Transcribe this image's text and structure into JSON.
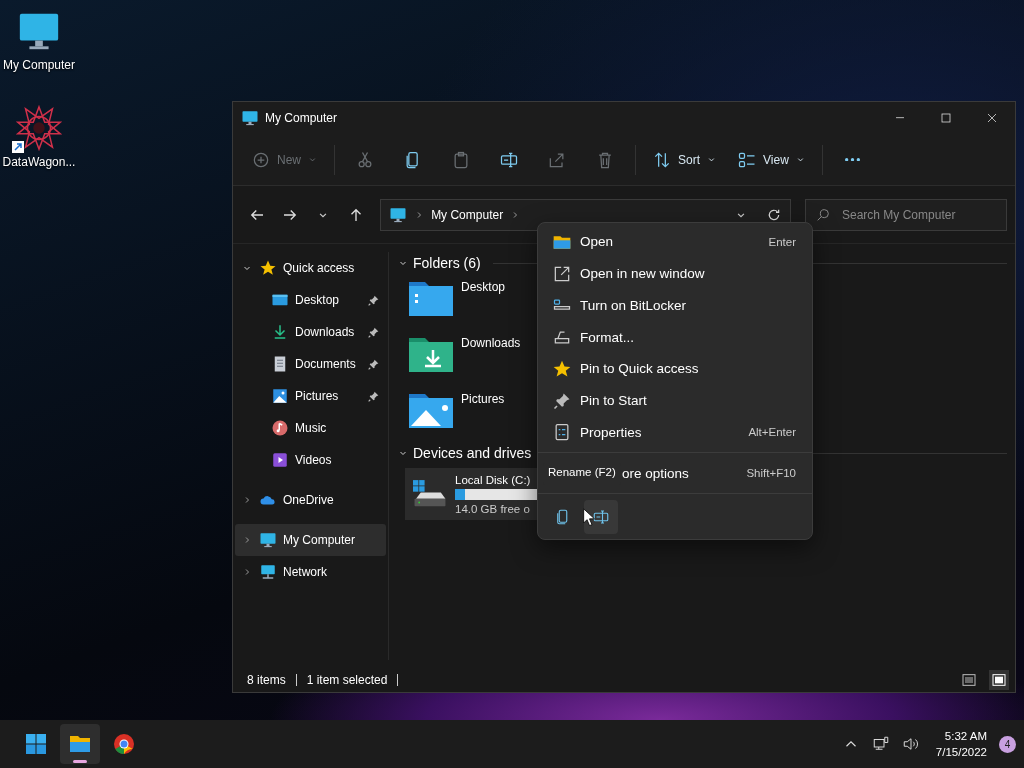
{
  "desktop_icons": [
    {
      "label": "My Computer",
      "kind": "computer"
    },
    {
      "label": "DataWagon...",
      "kind": "shortcut"
    }
  ],
  "window": {
    "title": "My Computer"
  },
  "toolbar": [
    {
      "kind": "new",
      "label": "New",
      "disabled": true
    },
    {
      "kind": "cut",
      "disabled": true
    },
    {
      "kind": "copy",
      "disabled": false
    },
    {
      "kind": "paste",
      "disabled": true
    },
    {
      "kind": "rename",
      "disabled": false
    },
    {
      "kind": "share",
      "disabled": true
    },
    {
      "kind": "delete",
      "disabled": true
    },
    {
      "kind": "sort",
      "label": "Sort",
      "disabled": false
    },
    {
      "kind": "view",
      "label": "View",
      "disabled": false
    },
    {
      "kind": "more",
      "disabled": false
    }
  ],
  "address": {
    "path": "My Computer"
  },
  "search": {
    "placeholder": "Search My Computer"
  },
  "sidebar": {
    "items": [
      {
        "label": "Quick access",
        "kind": "star",
        "expanded": true,
        "selected": false,
        "children": [
          {
            "label": "Desktop",
            "kind": "desktop",
            "pinned": true,
            "selected": false
          },
          {
            "label": "Downloads",
            "kind": "downloads",
            "pinned": true,
            "selected": false
          },
          {
            "label": "Documents",
            "kind": "documents",
            "pinned": true,
            "selected": false
          },
          {
            "label": "Pictures",
            "kind": "pictures",
            "pinned": true,
            "selected": false
          },
          {
            "label": "Music",
            "kind": "music",
            "pinned": false,
            "selected": false
          },
          {
            "label": "Videos",
            "kind": "videos",
            "pinned": false,
            "selected": false
          }
        ]
      },
      {
        "label": "OneDrive",
        "kind": "cloud",
        "expanded": false,
        "selected": false
      },
      {
        "label": "My Computer",
        "kind": "computer",
        "expanded": false,
        "selected": true
      },
      {
        "label": "Network",
        "kind": "network",
        "expanded": false,
        "selected": false
      }
    ]
  },
  "sections": [
    {
      "title": "Folders (6)",
      "expanded": true,
      "items": [
        {
          "label": "Desktop",
          "kind": "desktop"
        },
        {
          "label": "Downloads",
          "kind": "downloads"
        },
        {
          "label": "Pictures",
          "kind": "pictures"
        }
      ]
    },
    {
      "title": "Devices and drives",
      "expanded": true,
      "drives": [
        {
          "label": "Local Disk (C:)",
          "free": "14.0 GB free o",
          "level": 0.12,
          "selected": true
        }
      ]
    }
  ],
  "context_menu": {
    "items": [
      {
        "kind": "open",
        "label": "Open",
        "shortcut": "Enter"
      },
      {
        "kind": "newwindow",
        "label": "Open in new window"
      },
      {
        "kind": "bitlocker",
        "label": "Turn on BitLocker"
      },
      {
        "kind": "format",
        "label": "Format..."
      },
      {
        "kind": "star",
        "label": "Pin to Quick access"
      },
      {
        "kind": "pin",
        "label": "Pin to Start"
      },
      {
        "kind": "properties",
        "label": "Properties",
        "shortcut": "Alt+Enter"
      },
      {
        "kind": "more",
        "label": "ore options",
        "shortcut": "Shift+F10"
      }
    ],
    "quick_actions": [
      {
        "kind": "copy",
        "selected": false
      },
      {
        "kind": "rename",
        "selected": true
      }
    ],
    "tooltip": "Rename (F2)"
  },
  "status_bar": {
    "items": [
      "8 items",
      "1 item selected"
    ],
    "views": [
      {
        "kind": "details",
        "selected": false
      },
      {
        "kind": "tiles",
        "selected": true
      }
    ]
  },
  "taskbar": {
    "apps": [
      {
        "kind": "start",
        "selected": false
      },
      {
        "kind": "explorer",
        "selected": true
      },
      {
        "kind": "browser",
        "selected": false
      }
    ],
    "time": "5:32 AM",
    "date": "7/15/2022",
    "notifications": "4"
  }
}
